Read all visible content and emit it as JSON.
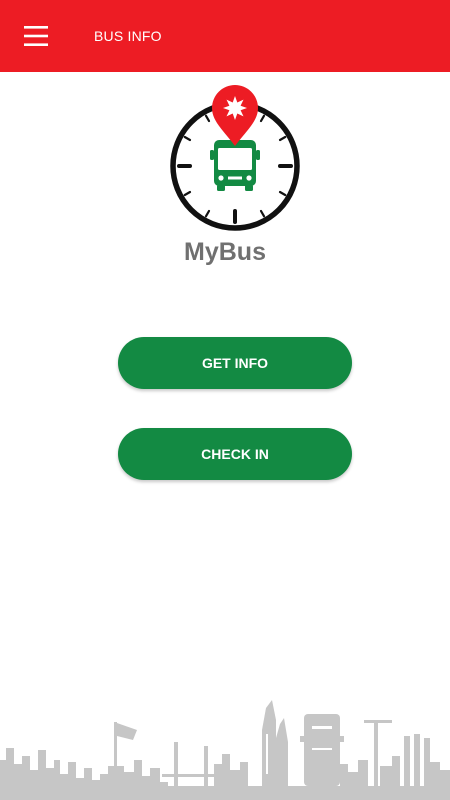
{
  "header": {
    "title": "BUS INFO",
    "menu_icon": "hamburger-menu-icon",
    "background_color": "#ED1C24"
  },
  "logo": {
    "icon": "bus-clock-pin-logo",
    "brand_name": "MyBus"
  },
  "actions": {
    "get_info_label": "GET INFO",
    "check_in_label": "CHECK IN",
    "button_color": "#138A43"
  },
  "footer": {
    "decoration": "city-skyline-illustration"
  }
}
